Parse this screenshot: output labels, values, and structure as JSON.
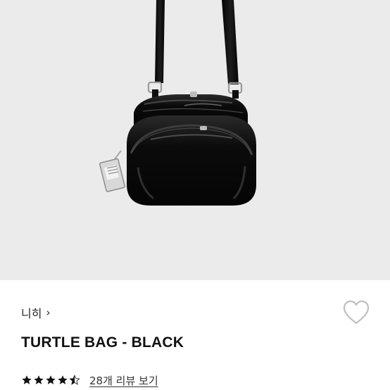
{
  "brand": {
    "name": "니히",
    "chevron": "›",
    "icon": "chevron-right-icon"
  },
  "product": {
    "title": "TURTLE BAG - BLACK",
    "image_subject": "black patent crossbody bag",
    "image_background_color": "#ebebeb"
  },
  "rating": {
    "stars_value": 4.5,
    "star_color": "#111111",
    "review_link_label": "28개 리뷰 보기"
  },
  "wishlist": {
    "icon": "heart-outline-icon",
    "color": "#bfbfbf"
  }
}
